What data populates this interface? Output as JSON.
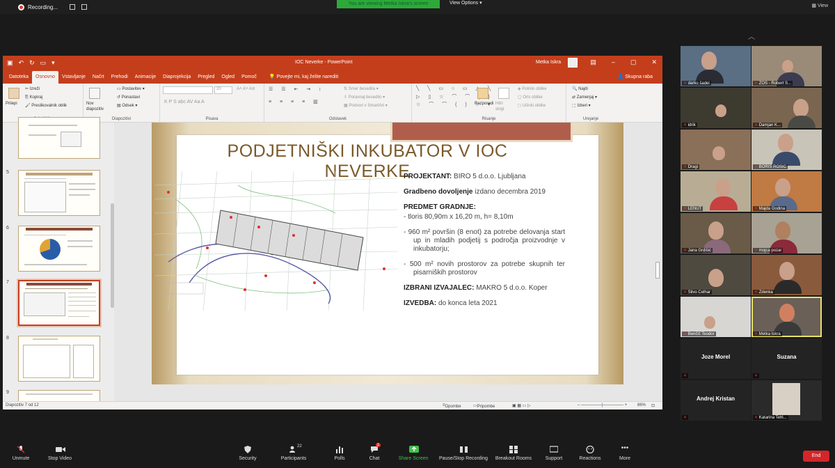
{
  "zoom_top": {
    "recording_label": "Recording...",
    "viewing_banner": "You are viewing Metka Iskra's screen",
    "view_options": "View Options",
    "view": "View"
  },
  "ppt": {
    "title": "IOC Neverke  -  PowerPoint",
    "user": "Metka Iskra",
    "tabs": [
      "Datoteka",
      "Osnovno",
      "Vstavljanje",
      "Načrt",
      "Prehodi",
      "Animacije",
      "Diaprojekcija",
      "Pregled",
      "Ogled",
      "Pomoč"
    ],
    "tell_me": "Povejte mi, kaj želite narediti",
    "share": "Skupna raba",
    "ribbon": {
      "clipboard_label": "Odložišče",
      "paste": "Prilepi",
      "cut": "Izreži",
      "copy": "Kopiraj",
      "format_painter": "Preslikovalnik oblik",
      "new_slide": "Nov diapozitiv",
      "layout": "Postavitev",
      "reset": "Ponastavi",
      "section": "Odsek",
      "slides_label": "Diapozitivi",
      "font_label": "Pisava",
      "font_size": "20",
      "font_buttons": "K  P  S  abc  AV  Aa  A",
      "paragraph_label": "Odstavek",
      "text_direction": "Smer besedila",
      "align_text": "Poravnaj besedilo",
      "smartart": "Pretvori v SmartArt",
      "drawing_label": "Risanje",
      "arrange": "Razporedi",
      "quick_styles": "Hitri slogi",
      "shape_fill": "Polnilo oblike",
      "shape_outline": "Oris oblike",
      "shape_effects": "Učinki oblike",
      "editing_label": "Urejanje",
      "find": "Najdi",
      "replace": "Zamenjaj",
      "select": "Izberi"
    },
    "thumb_numbers": [
      "5",
      "6",
      "7",
      "8",
      "9"
    ],
    "status_left": "Diapozitiv 7 od 12",
    "status_notes": "Opombe",
    "status_comments": "Pripombe",
    "status_zoom": "86%"
  },
  "slide": {
    "title": "PODJETNIŠKI INKUBATOR V IOC NEVERKE",
    "projektant_label": "PROJEKTANT:",
    "projektant_value": " BIRO 5 d.o.o. Ljubljana",
    "dovoljenje_label": "Gradbeno dovoljenje",
    "dovoljenje_value": " izdano decembra 2019",
    "predmet_label": "PREDMET GRADNJE:",
    "bullet1": "-   tloris 80,90m x 16,20 m, h= 8,10m",
    "bullet2": "-   960 m² površin (8 enot) za potrebe delovanja start up in mladih podjetij s področja proizvodnje v inkubatorju;",
    "bullet3": "-  500 m² novih prostorov za potrebe skupnih ter pisarniških prostorov",
    "izvajalec_label": "IZBRANI IZVAJALEC:",
    "izvajalec_value": " MAKRO 5 d.o.o. Koper",
    "izvedba_label": "IZVEDBA:",
    "izvedba_value": " do konca leta 2021"
  },
  "participants": [
    {
      "name": "darko šadel"
    },
    {
      "name": "ZOS - Robert S..."
    },
    {
      "name": "idrik"
    },
    {
      "name": "Damjan K..."
    },
    {
      "name": "Dragi"
    },
    {
      "name": "BORIS ROSIC"
    },
    {
      "name": "LENUT"
    },
    {
      "name": "Majda Godina"
    },
    {
      "name": "Jana Grdišić"
    },
    {
      "name": "mojca pozar"
    },
    {
      "name": "Silvo Celhar"
    },
    {
      "name": "Zdenka"
    },
    {
      "name": "Benčič Teodor"
    },
    {
      "name": "Metka Iskra"
    },
    {
      "name": "Joze Morel"
    },
    {
      "name": "Suzana"
    },
    {
      "name": "Andrej Kristan"
    },
    {
      "name": "Katarina Tehl..."
    }
  ],
  "toolbar": {
    "unmute": "Unmute",
    "stop_video": "Stop Video",
    "security": "Security",
    "participants": "Participants",
    "participants_count": "22",
    "polls": "Polls",
    "chat": "Chat",
    "chat_badge": "1",
    "share_screen": "Share Screen",
    "record": "Pause/Stop Recording",
    "breakout": "Breakout Rooms",
    "support": "Support",
    "reactions": "Reactions",
    "more": "More",
    "end": "End"
  },
  "colors": {
    "ppt_accent": "#c43e1c",
    "zoom_green": "#2fa83a",
    "end_red": "#d3262a",
    "slide_title": "#7a5a2a"
  }
}
